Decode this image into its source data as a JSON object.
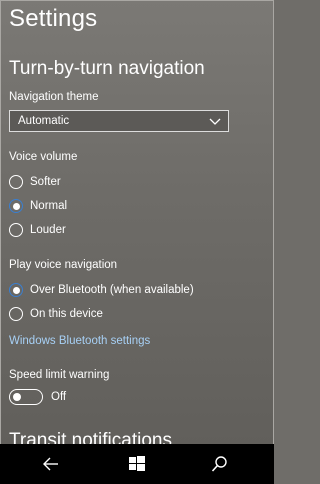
{
  "app": {
    "title": "Settings"
  },
  "section": {
    "title": "Turn-by-turn navigation"
  },
  "theme": {
    "label": "Navigation theme",
    "selected": "Automatic"
  },
  "voice_volume": {
    "label": "Voice volume",
    "options": [
      {
        "label": "Softer",
        "checked": false
      },
      {
        "label": "Normal",
        "checked": true
      },
      {
        "label": "Louder",
        "checked": false
      }
    ]
  },
  "play_voice": {
    "label": "Play voice navigation",
    "options": [
      {
        "label": "Over Bluetooth (when available)",
        "checked": true
      },
      {
        "label": "On this device",
        "checked": false
      }
    ]
  },
  "bluetooth_link": "Windows Bluetooth settings",
  "speed_limit": {
    "label": "Speed limit warning",
    "state": "Off"
  },
  "next_section": {
    "title": "Transit notifications"
  },
  "navbar": {
    "back": "back-arrow-icon",
    "start": "windows-logo-icon",
    "search": "search-icon"
  }
}
